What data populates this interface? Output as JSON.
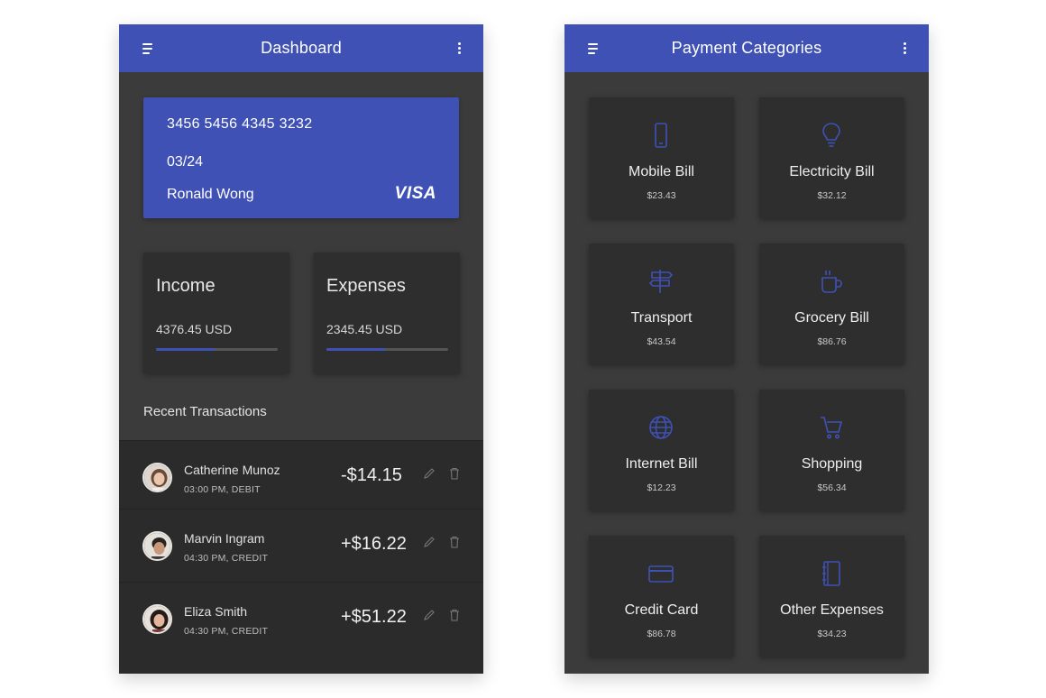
{
  "colors": {
    "accent": "#3f51b5",
    "surface": "#3b3b3b",
    "tile": "#2e2e2e",
    "text": "#ffffff"
  },
  "dashboard": {
    "title": "Dashboard",
    "card": {
      "number": "3456 5456 4345 3232",
      "expiry": "03/24",
      "holder": "Ronald Wong",
      "brand": "VISA"
    },
    "income": {
      "label": "Income",
      "amount": "4376.45 USD",
      "progress": 0.48
    },
    "expenses": {
      "label": "Expenses",
      "amount": "2345.45 USD",
      "progress": 0.48
    },
    "recent_title": "Recent Transactions",
    "transactions": [
      {
        "name": "Catherine Munoz",
        "meta": "03:00 PM, DEBIT",
        "amount": "-$14.15"
      },
      {
        "name": "Marvin Ingram",
        "meta": "04:30 PM, CREDIT",
        "amount": "+$16.22"
      },
      {
        "name": "Eliza Smith",
        "meta": "04:30 PM, CREDIT",
        "amount": "+$51.22"
      }
    ]
  },
  "categories": {
    "title": "Payment Categories",
    "items": [
      {
        "name": "Mobile Bill",
        "amount": "$23.43",
        "icon": "mobile-phone-icon"
      },
      {
        "name": "Electricity Bill",
        "amount": "$32.12",
        "icon": "light-bulb-icon"
      },
      {
        "name": "Transport",
        "amount": "$43.54",
        "icon": "signpost-icon"
      },
      {
        "name": "Grocery Bill",
        "amount": "$86.76",
        "icon": "coffee-cup-icon"
      },
      {
        "name": "Internet Bill",
        "amount": "$12.23",
        "icon": "globe-icon"
      },
      {
        "name": "Shopping",
        "amount": "$56.34",
        "icon": "shopping-cart-icon"
      },
      {
        "name": "Credit Card",
        "amount": "$86.78",
        "icon": "credit-card-icon"
      },
      {
        "name": "Other Expenses",
        "amount": "$34.23",
        "icon": "notebook-icon"
      }
    ]
  }
}
